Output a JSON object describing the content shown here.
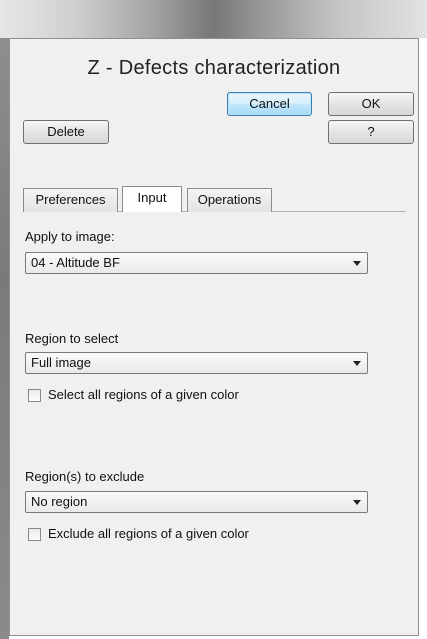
{
  "dialog": {
    "title": "Z - Defects characterization",
    "buttons": {
      "cancel": "Cancel",
      "ok": "OK",
      "delete": "Delete",
      "help": "?"
    },
    "tabs": [
      {
        "label": "Preferences",
        "active": false
      },
      {
        "label": "Input",
        "active": true
      },
      {
        "label": "Operations",
        "active": false
      }
    ]
  },
  "input_tab": {
    "apply_to_image": {
      "label": "Apply to image:",
      "value": "04 - Altitude BF"
    },
    "region_to_select": {
      "label": "Region to select",
      "value": "Full image",
      "checkbox_label": "Select all regions of a given color",
      "checked": false
    },
    "regions_to_exclude": {
      "label": "Region(s) to exclude",
      "value": "No region",
      "checkbox_label": "Exclude all regions of a given color",
      "checked": false
    }
  }
}
